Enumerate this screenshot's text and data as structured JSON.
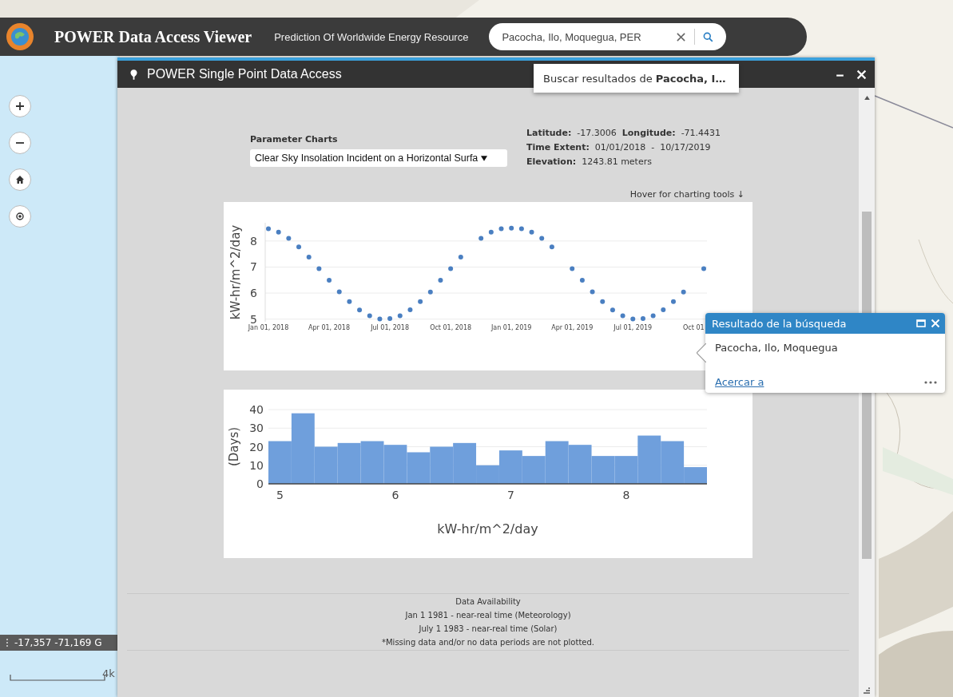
{
  "header": {
    "title": "POWER Data Access Viewer",
    "subtitle": "Prediction Of Worldwide Energy Resource",
    "search": {
      "value": "Pacocha, Ilo, Moquegua, PER"
    }
  },
  "search_suggestion": "Buscar resultados de **Pacocha, I…**",
  "map_status": {
    "coordinates": "-17,357 -71,169 G",
    "scale_label": "4k"
  },
  "panel": {
    "title": "POWER Single Point Data Access",
    "parameter": {
      "label": "Parameter Charts",
      "value": "Clear Sky Insolation Incident on a Horizontal Surfa"
    },
    "info": [
      [
        {
          "label": "Latitude:",
          "value": "-17.3006"
        },
        {
          "label": "Longitude:",
          "value": "-71.4431"
        }
      ],
      [
        {
          "label": "Time Extent:",
          "value": "01/01/2018  -  10/17/2019"
        }
      ],
      [
        {
          "label": "Elevation:",
          "value": "1243.81 meters"
        }
      ]
    ],
    "hint": "Hover for charting tools ↓",
    "time_series_chart": {
      "chart_data": {
        "type": "scatter",
        "grid": true,
        "ylabel": "kW-hr/m^2/day",
        "ylim": [
          4.9,
          8.7
        ],
        "categories": [
          "Jan 01, 2018",
          null,
          null,
          null,
          null,
          null,
          "Apr 01, 2018",
          null,
          null,
          null,
          null,
          null,
          "Jul 01, 2018",
          null,
          null,
          null,
          null,
          null,
          "Oct 01, 2018",
          null,
          null,
          null,
          null,
          null,
          "Jan 01, 2019",
          null,
          null,
          null,
          null,
          null,
          "Apr 01, 2019",
          null,
          null,
          null,
          null,
          null,
          "Jul 01, 2019",
          null,
          null,
          null,
          null,
          null,
          "Oct 01",
          null
        ],
        "series": [
          {
            "color": "#4a7fc1",
            "values": [
              8.47,
              8.34,
              8.1,
              7.77,
              7.38,
              6.94,
              6.49,
              6.05,
              5.67,
              5.35,
              5.13,
              5.01,
              5.02,
              5.13,
              5.36,
              5.67,
              6.04,
              6.49,
              6.94,
              7.38,
              null,
              8.1,
              8.34,
              8.47,
              8.49,
              8.47,
              8.34,
              8.1,
              7.77,
              null,
              6.94,
              6.49,
              6.05,
              5.67,
              5.35,
              5.13,
              5.01,
              5.02,
              5.13,
              5.36,
              5.67,
              6.04,
              null,
              6.94
            ]
          }
        ],
        "yticks": [
          5,
          6,
          7,
          8
        ]
      }
    },
    "histogram": {
      "chart_data": {
        "type": "bar",
        "grid": true,
        "xlabel": "kW-hr/m^2/day",
        "ylabel": "(Days)",
        "xlim": [
          4.9,
          8.7
        ],
        "ylim": [
          0,
          40
        ],
        "x": [
          5.0,
          5.2,
          5.4,
          5.6,
          5.8,
          6.0,
          6.2,
          6.4,
          6.6,
          6.8,
          7.0,
          7.2,
          7.4,
          7.6,
          7.8,
          8.0,
          8.2,
          8.4,
          8.6
        ],
        "series": [
          {
            "color": "#6f9fdc",
            "values": [
              23,
              38,
              20,
              22,
              23,
              21,
              17,
              20,
              22,
              10,
              18,
              15,
              23,
              21,
              15,
              15,
              26,
              23,
              9
            ]
          }
        ],
        "xticks": [
          5,
          6,
          7,
          8
        ],
        "yticks": [
          0,
          10,
          20,
          30,
          40
        ]
      }
    },
    "footer": [
      "Data Availability",
      "Jan 1 1981 - near-real time (Meteorology)",
      "July 1 1983 - near-real time (Solar)",
      "*Missing data and/or no data periods are not plotted."
    ]
  },
  "popup": {
    "title": "Resultado de la búsqueda",
    "body": "Pacocha, Ilo, Moquegua",
    "link": "Acercar a"
  }
}
